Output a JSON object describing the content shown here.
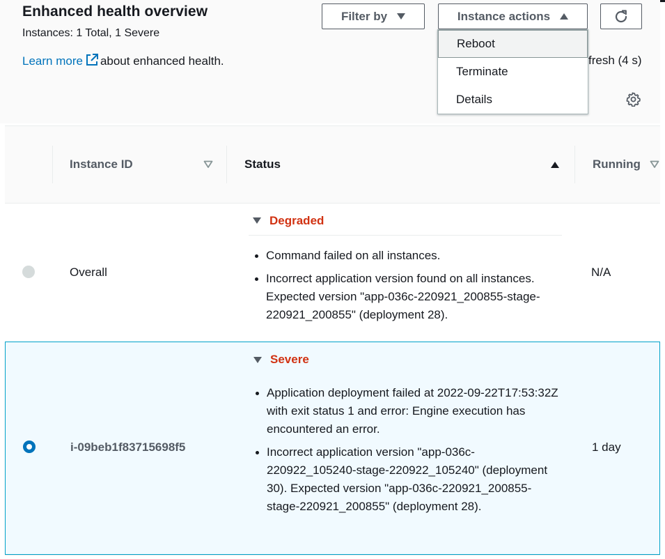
{
  "header": {
    "title": "Enhanced health overview",
    "counts": "Instances: 1 Total, 1 Severe",
    "learn_more": "Learn more",
    "learn_suffix": "about enhanced health.",
    "refresh_text": "fresh (4 s)"
  },
  "toolbar": {
    "filter_label": "Filter by",
    "actions_label": "Instance actions"
  },
  "actions_menu": {
    "items": [
      {
        "label": "Reboot"
      },
      {
        "label": "Terminate"
      },
      {
        "label": "Details"
      }
    ]
  },
  "table": {
    "columns": {
      "instance_id": "Instance ID",
      "status": "Status",
      "running": "Running"
    },
    "rows": [
      {
        "selected": false,
        "instance_id": "Overall",
        "status": "Degraded",
        "causes": [
          "Command failed on all instances.",
          "Incorrect application version found on all instances. Expected version \"app-036c-220921_200855-stage-220921_200855\" (deployment 28)."
        ],
        "running": "N/A"
      },
      {
        "selected": true,
        "instance_id": "i-09beb1f83715698f5",
        "status": "Severe",
        "causes": [
          "Application deployment failed at 2022-09-22T17:53:32Z with exit status 1 and error: Engine execution has encountered an error.",
          "Incorrect application version \"app-036c-220922_105240-stage-220922_105240\" (deployment 30). Expected version \"app-036c-220921_200855-stage-220921_200855\" (deployment 28)."
        ],
        "running": "1 day"
      }
    ]
  },
  "colors": {
    "link": "#0073bb",
    "status_error": "#d13212",
    "selected_row_bg": "#f1faff",
    "selected_row_border": "#00a1c9"
  },
  "icons": [
    "external-link-icon",
    "caret-down-icon",
    "caret-up-icon",
    "refresh-icon",
    "settings-gear-icon",
    "sort-icon",
    "expand-caret-icon",
    "radio-icon"
  ]
}
